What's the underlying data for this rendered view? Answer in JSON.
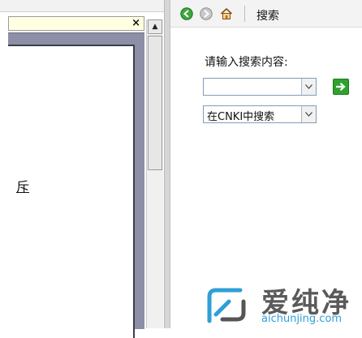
{
  "left_pane": {
    "close_glyph": "×",
    "doc_fragment": "斥",
    "scroll_up_glyph": "▲"
  },
  "toolbar": {
    "back_icon": "green-back-arrow-icon",
    "forward_icon": "gray-forward-arrow-icon",
    "home_icon": "home-icon",
    "title": "搜索"
  },
  "search": {
    "prompt": "请输入搜索内容:",
    "query_value": "",
    "scope_selected": "在CNKI中搜索",
    "go_icon": "go-arrow-icon"
  },
  "watermark": {
    "brand": "爱纯净",
    "url": "aichunjing.com"
  },
  "colors": {
    "yellow_info_bar": "#ffffe1",
    "doc_frame": "#8d8fa6",
    "go_green": "#2fa12f",
    "watermark_blue": "#2f9fd6"
  }
}
